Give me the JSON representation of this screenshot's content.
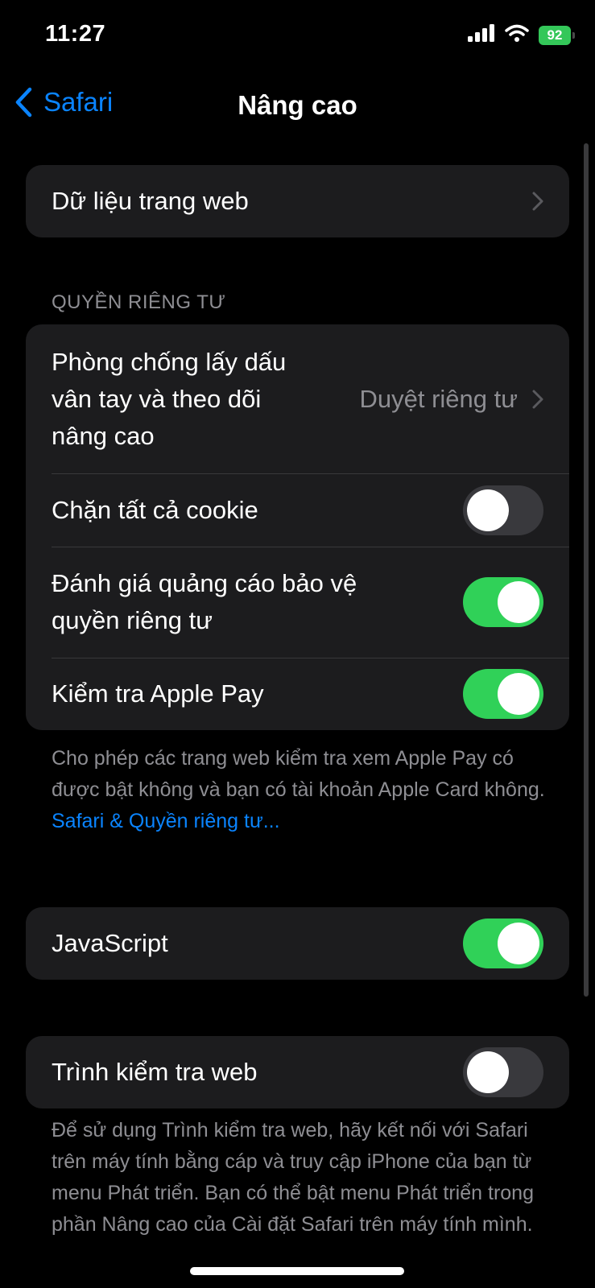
{
  "status": {
    "time": "11:27",
    "battery": "92"
  },
  "nav": {
    "back_label": "Safari",
    "title": "Nâng cao"
  },
  "website_data": {
    "label": "Dữ liệu trang web"
  },
  "privacy": {
    "header": "QUYỀN RIÊNG TƯ",
    "fingerprint": {
      "label": "Phòng chống lấy dấu vân tay và theo dõi nâng cao",
      "value": "Duyệt riêng tư"
    },
    "block_cookies": {
      "label": "Chặn tất cả cookie",
      "enabled": false
    },
    "ad_measurement": {
      "label": "Đánh giá quảng cáo bảo vệ quyền riêng tư",
      "enabled": true
    },
    "apple_pay": {
      "label": "Kiểm tra Apple Pay",
      "enabled": true
    },
    "footer": "Cho phép các trang web kiểm tra xem Apple Pay có được bật không và bạn có tài khoản Apple Card không.",
    "footer_link": "Safari & Quyền riêng tư..."
  },
  "javascript": {
    "label": "JavaScript",
    "enabled": true
  },
  "web_inspector": {
    "label": "Trình kiểm tra web",
    "enabled": false,
    "footer": "Để sử dụng Trình kiểm tra web, hãy kết nối với Safari trên máy tính bằng cáp và truy cập iPhone của bạn từ menu Phát triển. Bạn có thể bật menu Phát triển trong phần Nâng cao của Cài đặt Safari trên máy tính mình."
  },
  "colors": {
    "accent": "#0a84ff",
    "toggle_on": "#30d158",
    "cell_bg": "#1c1c1e",
    "secondary_text": "#8e8e93"
  },
  "icons": [
    "back-chevron-icon",
    "chevron-right-icon",
    "signal-icon",
    "wifi-icon",
    "battery-icon"
  ]
}
